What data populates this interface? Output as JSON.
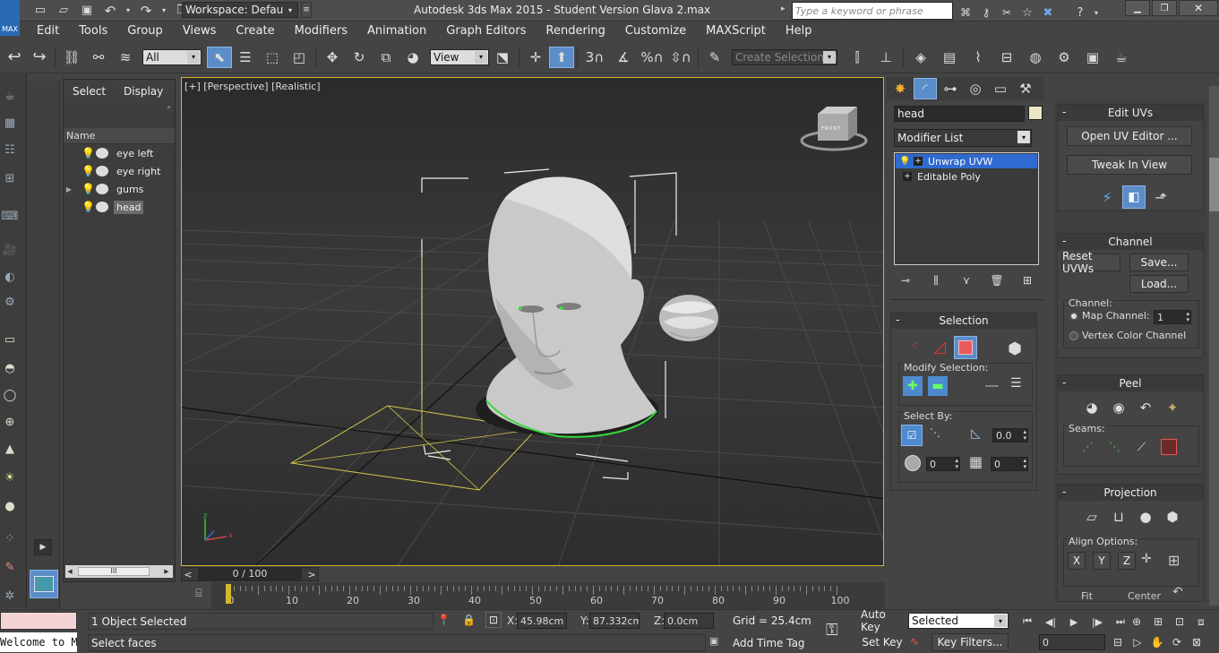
{
  "titlebar": {
    "logo": "MAX",
    "workspace": "Workspace: Default",
    "title": "Autodesk 3ds Max  2015  - Student Version  Glava 2.max",
    "search_placeholder": "Type a keyword or phrase"
  },
  "menus": [
    "Edit",
    "Tools",
    "Group",
    "Views",
    "Create",
    "Modifiers",
    "Animation",
    "Graph Editors",
    "Rendering",
    "Customize",
    "MAXScript",
    "Help"
  ],
  "toolbar": {
    "filter": "All",
    "view_ref": "View",
    "selection_set": "Create Selection Se"
  },
  "scene_explorer": {
    "tabs": [
      "Select",
      "Display"
    ],
    "column": "Name",
    "items": [
      {
        "name": "eye left",
        "selected": false,
        "expandable": false
      },
      {
        "name": "eye right",
        "selected": false,
        "expandable": false
      },
      {
        "name": "gums",
        "selected": false,
        "expandable": true
      },
      {
        "name": "head",
        "selected": true,
        "expandable": false
      }
    ],
    "scroll_label": "III"
  },
  "viewport": {
    "label": "[+] [Perspective] [Realistic]",
    "viewcube_label": "FRONT",
    "axis_x": "x",
    "axis_z": "z"
  },
  "timeline": {
    "frame": "0 / 100",
    "prev": "<",
    "next": ">",
    "ticks": [
      "0",
      "10",
      "20",
      "30",
      "40",
      "50",
      "60",
      "70",
      "80",
      "90",
      "100"
    ]
  },
  "command_panel": {
    "object_name": "head",
    "modifier_list": "Modifier List",
    "stack": [
      {
        "name": "Unwrap UVW",
        "active": true
      },
      {
        "name": "Editable Poly",
        "active": false
      }
    ]
  },
  "selection_rollout": {
    "title": "Selection",
    "modify_label": "Modify Selection:",
    "select_by_label": "Select By:",
    "angle_value": "0.0",
    "spin1": "0",
    "spin2": "0"
  },
  "edit_uvs": {
    "title": "Edit UVs",
    "open_editor": "Open UV Editor ...",
    "tweak": "Tweak In View"
  },
  "channel": {
    "title": "Channel",
    "reset": "Reset UVWs",
    "save": "Save...",
    "load": "Load...",
    "label": "Channel:",
    "map_channel": "Map Channel:",
    "map_value": "1",
    "vertex_color": "Vertex Color Channel"
  },
  "peel": {
    "title": "Peel",
    "seams": "Seams:"
  },
  "projection": {
    "title": "Projection",
    "align": "Align Options:",
    "axes": [
      "X",
      "Y",
      "Z"
    ],
    "fit": "Fit",
    "center": "Center"
  },
  "status": {
    "maxscript_listener": "",
    "welcome": "Welcome to M",
    "objects": "1 Object Selected",
    "prompt": "Select faces",
    "x_label": "X:",
    "x_val": "45.98cm",
    "y_label": "Y:",
    "y_val": "87.332cm",
    "z_label": "Z:",
    "z_val": "0.0cm",
    "grid": "Grid = 25.4cm",
    "add_time_tag": "Add Time Tag",
    "auto_key": "Auto Key",
    "set_key": "Set Key",
    "selected": "Selected",
    "key_filters": "Key Filters...",
    "frame_field": "0"
  }
}
